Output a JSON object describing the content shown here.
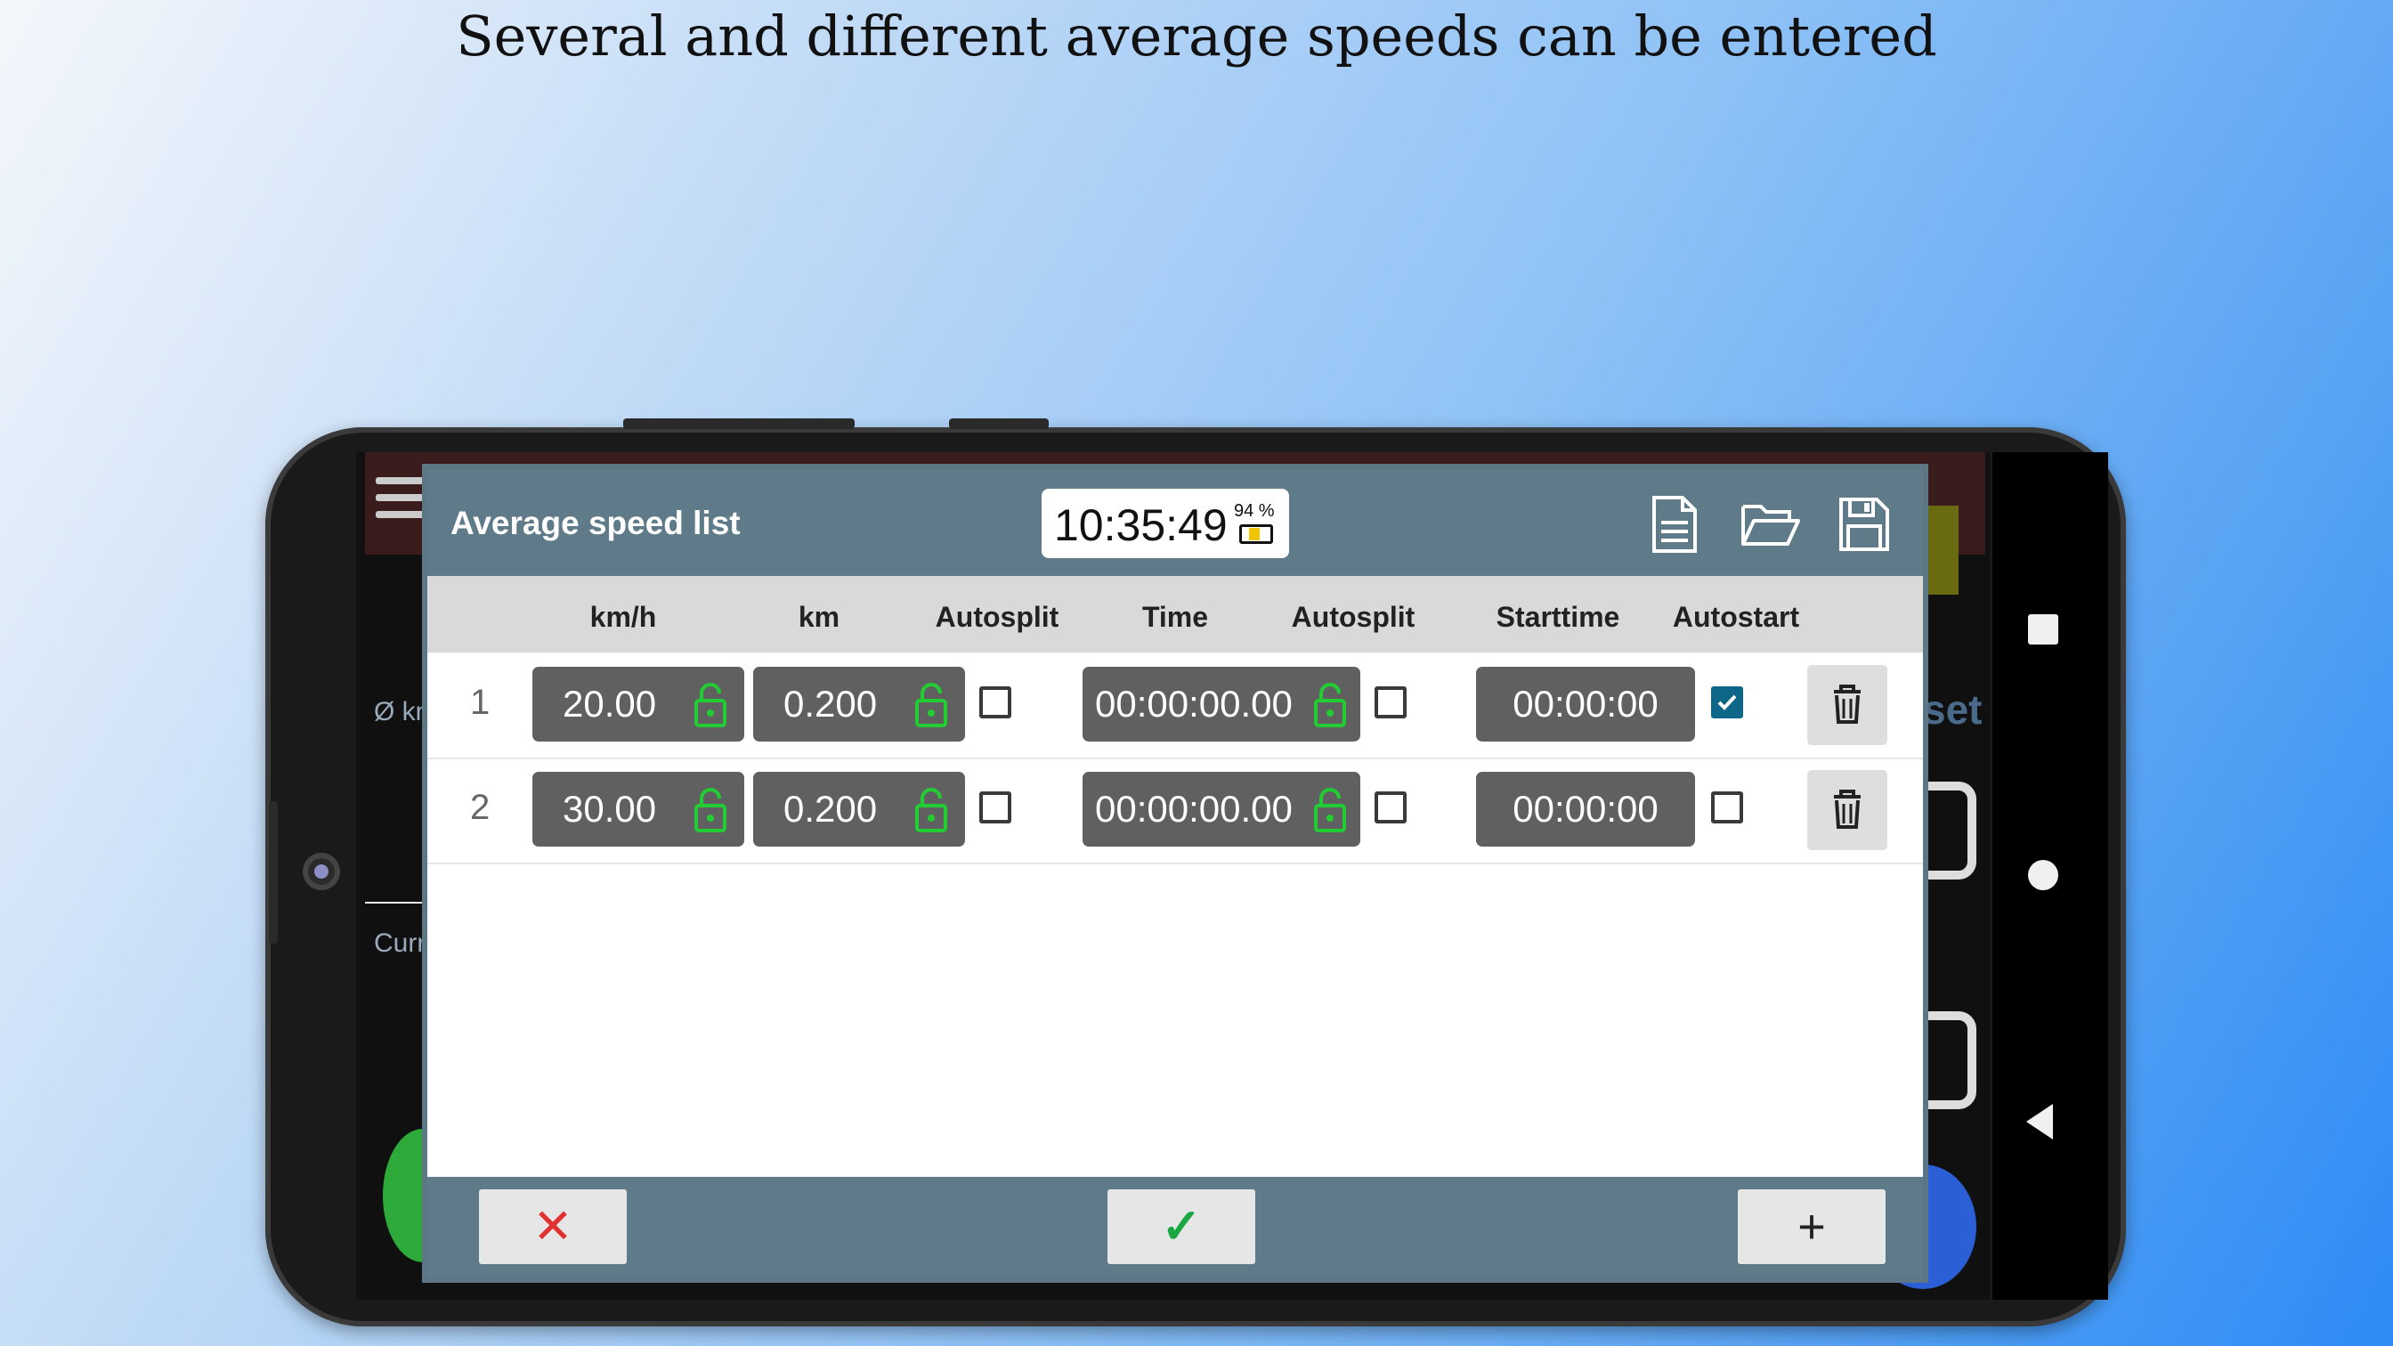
{
  "caption": "Several and different average speeds can be entered",
  "dialog": {
    "title": "Average speed list",
    "clock": {
      "time": "10:35:49",
      "battery": "94 %"
    },
    "icons": [
      "new-document-icon",
      "open-folder-icon",
      "save-icon"
    ],
    "columns": [
      "km/h",
      "km",
      "Autosplit",
      "Time",
      "Autosplit",
      "Starttime",
      "Autostart"
    ],
    "rows": [
      {
        "num": "1",
        "speed": "20.00",
        "distance": "0.200",
        "autosplit_distance": false,
        "time": "00:00:00.00",
        "autosplit_time": false,
        "starttime": "00:00:00",
        "autostart": true
      },
      {
        "num": "2",
        "speed": "30.00",
        "distance": "0.200",
        "autosplit_distance": false,
        "time": "00:00:00.00",
        "autosplit_time": false,
        "starttime": "00:00:00",
        "autostart": false
      }
    ],
    "footer": {
      "cancel": "✕",
      "confirm": "✓",
      "add": "+"
    }
  },
  "background_app": {
    "label_avg": "Ø km",
    "label_curr": "Curr",
    "label_reset": "set"
  },
  "colors": {
    "dialog_header": "#5f7b8a",
    "field_bg": "#606060",
    "lock": "#22cc33",
    "checkbox_checked": "#0e6688",
    "cancel": "#e03030",
    "confirm": "#1aa640"
  }
}
